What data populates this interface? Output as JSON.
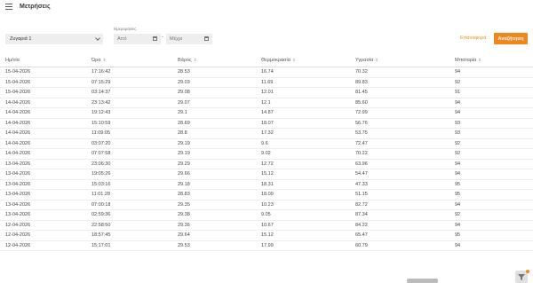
{
  "header": {
    "title": "Μετρήσεις",
    "menu_icon": "hamburger-menu-icon"
  },
  "filters": {
    "device_value": "Ζυγαριά 1",
    "date_label": "Ημερομηνίες",
    "from_placeholder": "Από",
    "to_placeholder": "Μέχρι",
    "separator": "-",
    "reset_label": "Επαναφορά",
    "search_label": "Αναζήτηση",
    "accent": "#f0871c"
  },
  "table": {
    "columns": [
      "Ημ/νία",
      "Ώρα",
      "Βάρος",
      "Θερμοκρασία",
      "Υγρασία",
      "Μπαταρία"
    ],
    "rows": [
      [
        "15-04-2026",
        "17:16:42",
        "28.53",
        "16.74",
        "70.32",
        "94"
      ],
      [
        "15-04-2026",
        "07:15:29",
        "29.03",
        "11.69",
        "89.83",
        "92"
      ],
      [
        "15-04-2026",
        "03:14:37",
        "29.08",
        "12.01",
        "81.45",
        "91"
      ],
      [
        "14-04-2026",
        "23:13:42",
        "29.07",
        "12.1",
        "85.60",
        "94"
      ],
      [
        "14-04-2026",
        "19:12:43",
        "29.1",
        "14.87",
        "72.99",
        "94"
      ],
      [
        "14-04-2026",
        "15:10:59",
        "28.69",
        "18.07",
        "56.76",
        "93"
      ],
      [
        "14-04-2026",
        "11:09:05",
        "28.8",
        "17.32",
        "53.75",
        "93"
      ],
      [
        "14-04-2026",
        "03:07:20",
        "29.19",
        "9.6",
        "72.47",
        "92"
      ],
      [
        "14-04-2026",
        "07:07:58",
        "29.19",
        "9.02",
        "70.22",
        "92"
      ],
      [
        "13-04-2026",
        "23:06:30",
        "29.29",
        "12.72",
        "63.96",
        "94"
      ],
      [
        "13-04-2026",
        "19:05:26",
        "29.66",
        "15.12",
        "54.47",
        "94"
      ],
      [
        "13-04-2026",
        "15:03:16",
        "29.18",
        "18.31",
        "47.33",
        "95"
      ],
      [
        "13-04-2026",
        "11:01:28",
        "28.83",
        "18.09",
        "51.15",
        "95"
      ],
      [
        "13-04-2026",
        "07:00:18",
        "29.35",
        "10.23",
        "82.72",
        "94"
      ],
      [
        "13-04-2026",
        "02:59:36",
        "29.38",
        "9.05",
        "87.34",
        "92"
      ],
      [
        "12-04-2026",
        "22:58:50",
        "29.36",
        "10.67",
        "84.22",
        "94"
      ],
      [
        "12-04-2026",
        "18:57:45",
        "29.64",
        "15.12",
        "65.47",
        "95"
      ],
      [
        "12-04-2026",
        "15:17:01",
        "29.53",
        "17.99",
        "60.79",
        "94"
      ]
    ]
  }
}
